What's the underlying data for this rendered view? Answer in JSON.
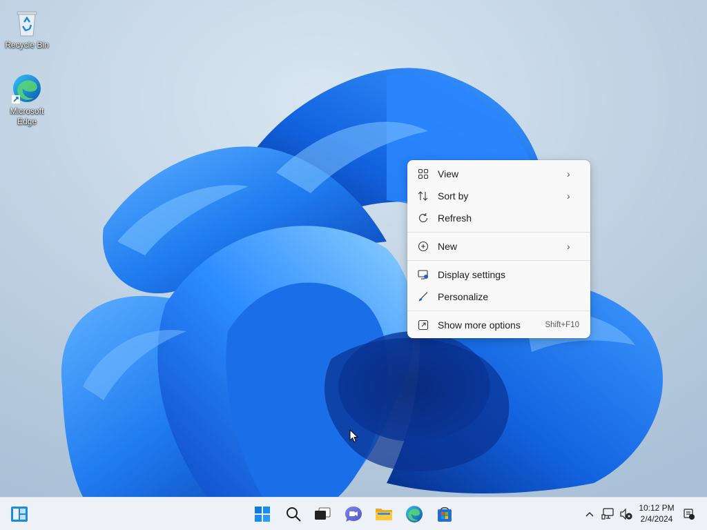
{
  "desktop": {
    "icons": [
      {
        "label": "Recycle Bin",
        "icon": "recycle-bin-icon"
      },
      {
        "label": "Microsoft\nEdge",
        "icon": "edge-icon"
      }
    ]
  },
  "context_menu": {
    "items": [
      {
        "label": "View",
        "icon": "view-grid-icon",
        "submenu": true
      },
      {
        "label": "Sort by",
        "icon": "sort-icon",
        "submenu": true
      },
      {
        "label": "Refresh",
        "icon": "refresh-icon"
      },
      {
        "label": "New",
        "icon": "new-plus-icon",
        "submenu": true
      },
      {
        "label": "Display settings",
        "icon": "display-settings-icon"
      },
      {
        "label": "Personalize",
        "icon": "personalize-brush-icon"
      },
      {
        "label": "Show more options",
        "icon": "show-more-icon",
        "shortcut": "Shift+F10"
      }
    ]
  },
  "taskbar": {
    "apps": [
      "widgets-icon",
      "start-icon",
      "search-icon",
      "task-view-icon",
      "chat-icon",
      "file-explorer-icon",
      "edge-icon",
      "store-icon"
    ],
    "tray": {
      "time": "10:12 PM",
      "date": "2/4/2024"
    }
  },
  "colors": {
    "accent": "#0067c0",
    "wallpaper_blue": "#1a6fe8",
    "menu_bg": "#f9f9f9",
    "taskbar_bg": "#eef2f6"
  }
}
